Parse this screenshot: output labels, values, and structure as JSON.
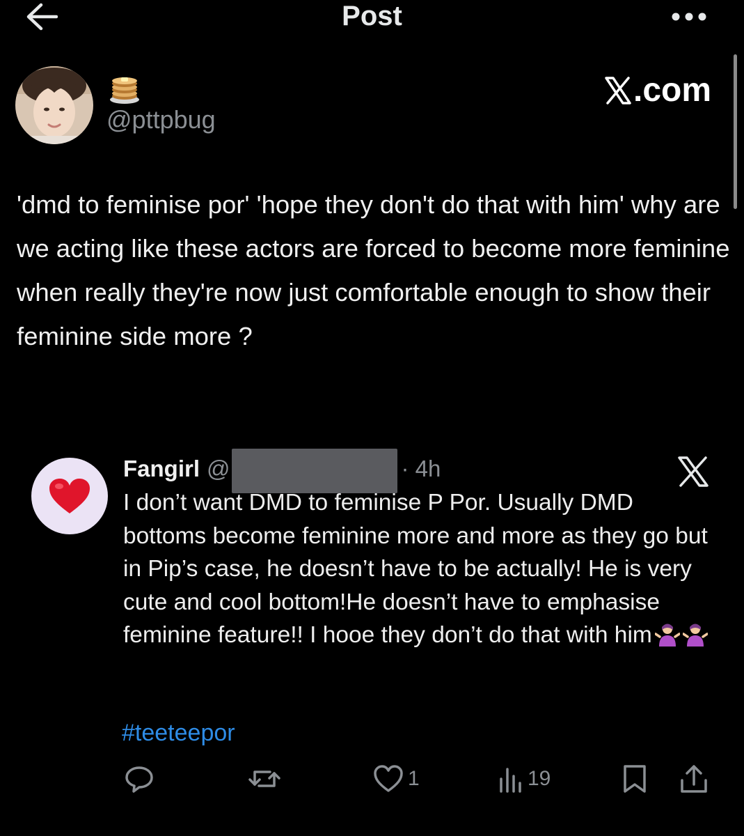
{
  "header": {
    "title": "Post"
  },
  "author": {
    "display_emoji": "pancakes",
    "handle": "@pttpbug",
    "watermark": ".com"
  },
  "post": {
    "text": "'dmd to feminise por' 'hope they don't do that with him' why are we acting like these actors are forced to become more feminine when really they're now just comfortable enough to show their feminine side more ?"
  },
  "quoted_post": {
    "name": "Fangirl",
    "at": "@",
    "time": "· 4h",
    "text": "I don’t want DMD to feminise P Por. Usually DMD bottoms become feminine more and more as they go but in Pip’s case, he doesn’t have to be actually! He is very cute and cool bottom!He doesn’t have to emphasise feminine feature!! I hooe they don’t do that with him",
    "hashtag": "#teeteepor"
  },
  "actions": {
    "likes": "1",
    "views": "19"
  },
  "icons": {
    "back": "arrow-left-icon",
    "more": "more-dots-icon",
    "x_logo": "x-logo-icon",
    "heart": "red-heart-icon",
    "shrug": "person-shrugging-icon",
    "reply": "reply-icon",
    "repost": "repost-icon",
    "like": "like-icon",
    "views": "views-icon",
    "bookmark": "bookmark-icon",
    "share": "share-icon"
  },
  "colors": {
    "background": "#000000",
    "text": "#e7e9ea",
    "secondary": "#8b8f94",
    "link": "#2e8ce6",
    "heart": "#e0152b"
  }
}
